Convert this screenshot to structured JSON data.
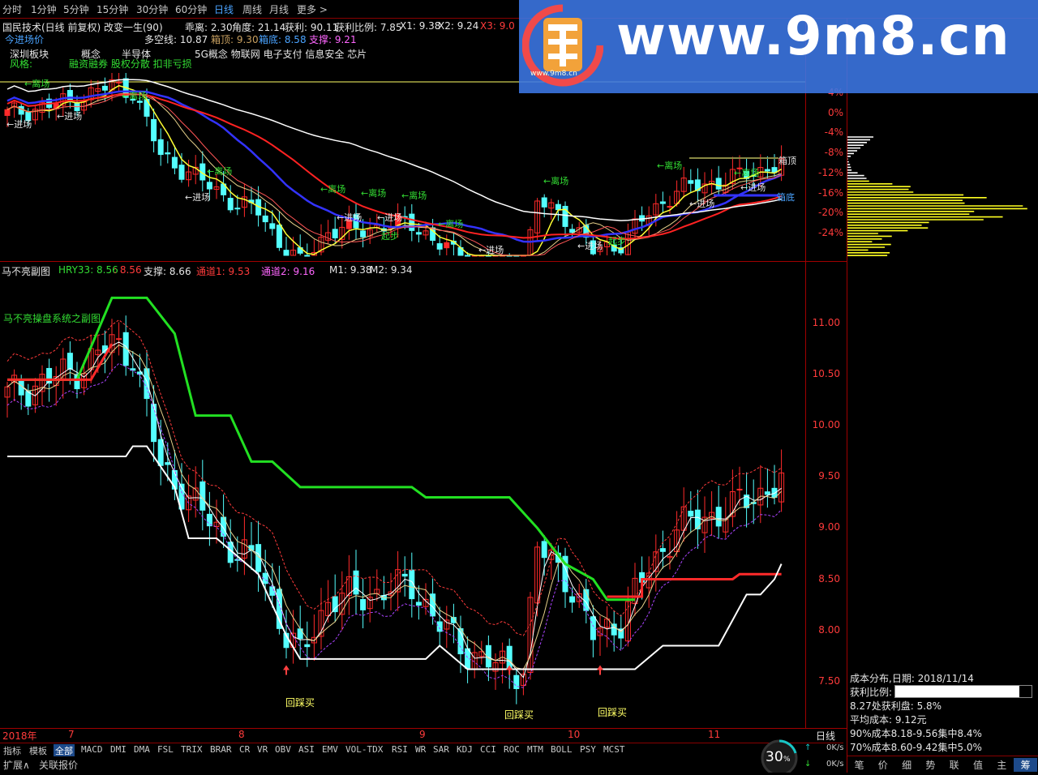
{
  "topbar": {
    "tabs": [
      "分时",
      "1分钟",
      "5分钟",
      "15分钟",
      "30分钟",
      "60分钟",
      "日线",
      "周线",
      "月线",
      "更多 >"
    ],
    "active": "日线"
  },
  "main": {
    "title": "国民技术(日线 前复权) 改变一生(90)",
    "stats": [
      {
        "label": "乖离: 2.30",
        "color": "#e6e6e6"
      },
      {
        "label": "角度: 21.14",
        "color": "#e6e6e6"
      },
      {
        "label": "获利: 90.11",
        "color": "#e6e6e6"
      },
      {
        "label": "获利比例: 7.85",
        "color": "#e6e6e6"
      },
      {
        "label": "X1: 9.38",
        "color": "#e6e6e6"
      },
      {
        "label": "X2: 9.24",
        "color": "#e6e6e6"
      },
      {
        "label": "X3: 9.0",
        "color": "#ff3b3b"
      }
    ],
    "line2_left": "今进场价",
    "line2_items": [
      {
        "label": "多空线: 10.87",
        "color": "#e6e6e6"
      },
      {
        "label": "箱顶: 9.30",
        "color": "#c8a060"
      },
      {
        "label": "箱底: 8.58",
        "color": "#4aa3ff"
      },
      {
        "label": "支撑: 9.21",
        "color": "#ff66ff"
      }
    ],
    "tags": [
      "深圳板块",
      "概念",
      "半导体",
      "5G概念 物联网 电子支付 信息安全 芯片"
    ],
    "style_label": "风格:",
    "style_value": "融资融券 股权分散 扣非亏损",
    "y_axis": [
      "4%",
      "0%",
      "-4%",
      "-8%",
      "-12%",
      "-16%",
      "-20%",
      "-24%"
    ],
    "annotations": {
      "enter": "←进场",
      "leave": "←离场",
      "leave2": "离场",
      "start": "起步",
      "top": "箱顶",
      "bottom": "箱底"
    }
  },
  "sub": {
    "title": "马不亮副图",
    "values": [
      {
        "label": "HRY33: 8.56",
        "color": "#33dd33"
      },
      {
        "label": ": 8.56",
        "color": "#ff3b3b"
      },
      {
        "label": "支撑: 8.66",
        "color": "#e6e6e6"
      },
      {
        "label": "通道1: 9.53",
        "color": "#ff3b3b"
      },
      {
        "label": "通道2: 9.16",
        "color": "#ff66ff"
      },
      {
        "label": "M1: 9.38",
        "color": "#e6e6e6"
      },
      {
        "label": "M2: 9.34",
        "color": "#e6e6e6"
      }
    ],
    "system_label": "马不亮操盘系统之副图",
    "y_axis": [
      "11.00",
      "10.50",
      "10.00",
      "9.50",
      "9.00",
      "8.50",
      "8.00",
      "7.50"
    ],
    "buy_label": "回踩买"
  },
  "x_axis": {
    "labels": [
      "2018年",
      "7",
      "8",
      "9",
      "10",
      "11"
    ],
    "period": "日线"
  },
  "bottom_tabs": [
    "指标",
    "模板",
    "全部",
    "MACD",
    "DMI",
    "DMA",
    "FSL",
    "TRIX",
    "BRAR",
    "CR",
    "VR",
    "OBV",
    "ASI",
    "EMV",
    "VOL-TDX",
    "RSI",
    "WR",
    "SAR",
    "KDJ",
    "CCI",
    "ROC",
    "MTM",
    "BOLL",
    "PSY",
    "MCST"
  ],
  "bottom_active": "全部",
  "bottom2": [
    "扩展∧",
    "关联报价"
  ],
  "cost_panel": {
    "date_line": "成本分布,日期:  2018/11/14",
    "profit_label": "获利比例:",
    "profit_value": "91.0%",
    "profit_pct": 0.91,
    "line3": "8.27处获利盘:  5.8%",
    "line4": "平均成本:  9.12元",
    "line5": "90%成本8.18-9.56集中8.4%",
    "line6": "70%成本8.60-9.42集中5.0%"
  },
  "right_tabs": [
    "笔",
    "价",
    "细",
    "势",
    "联",
    "值",
    "主",
    "筹"
  ],
  "right_active": "筹",
  "speed": {
    "percent": "30",
    "unit": "%",
    "up": "0K/s",
    "down": "0K/s"
  },
  "watermark": {
    "text": "www.9m8.cn",
    "small": "www.9m8.cn"
  },
  "colors": {
    "up": "#ff2a2a",
    "down": "#54ffff",
    "green": "#22e022",
    "yellow": "#ffff33",
    "blue": "#2222ff",
    "white": "#ffffff",
    "magenta": "#ff44ff"
  }
}
